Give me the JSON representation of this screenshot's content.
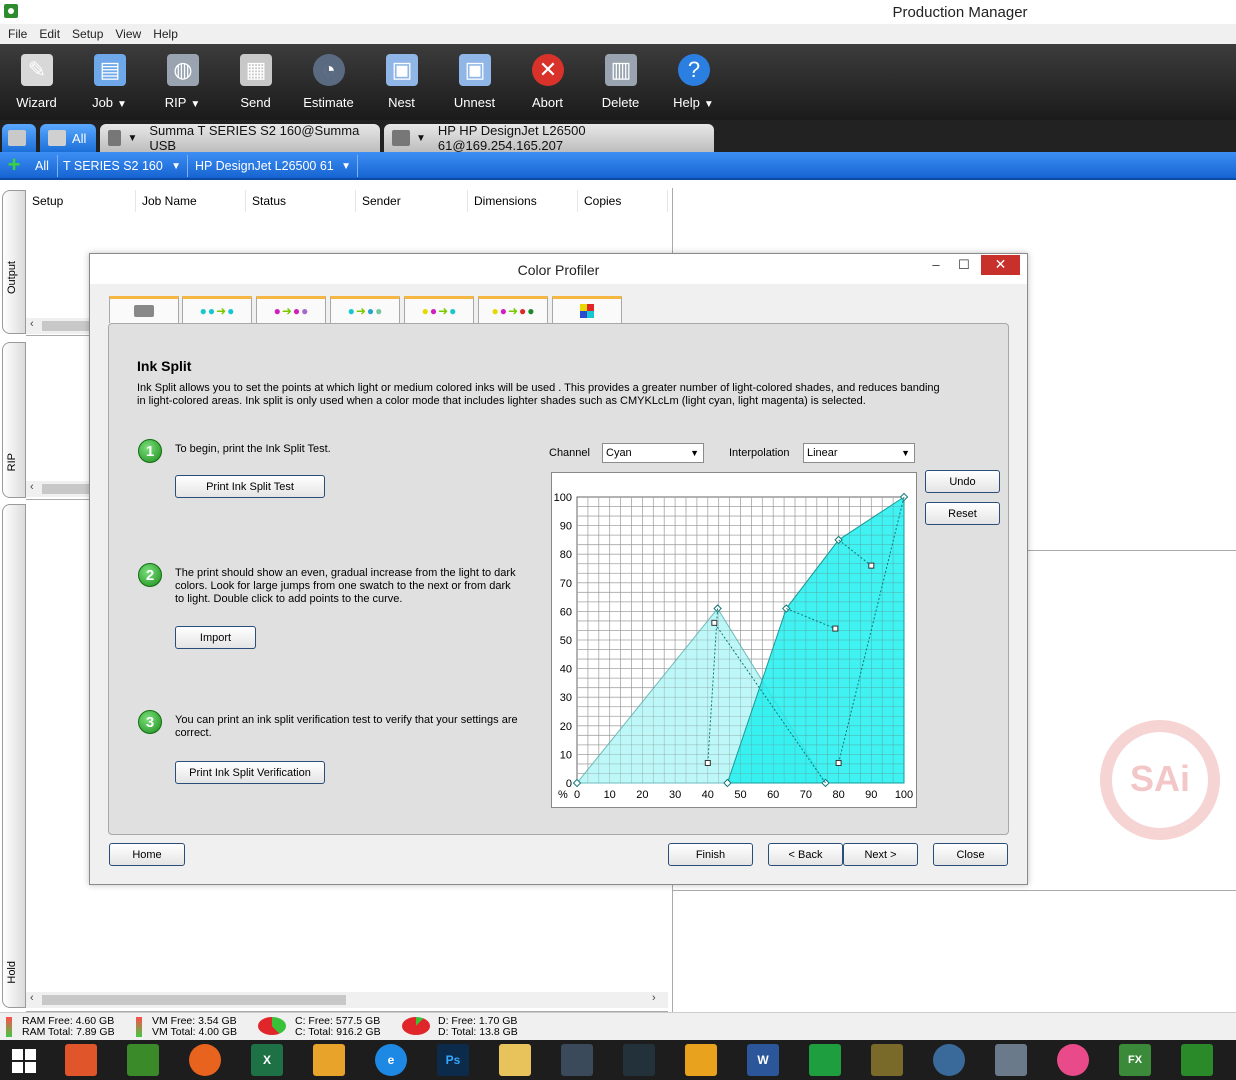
{
  "app": {
    "title": "Production Manager"
  },
  "menu": [
    "File",
    "Edit",
    "Setup",
    "View",
    "Help"
  ],
  "toolbar": [
    {
      "label": "Wizard",
      "icon": "wizard-icon",
      "color": "#d8d8d8",
      "dropdown": false
    },
    {
      "label": "Job",
      "icon": "folder-icon",
      "color": "#6fa8e8",
      "dropdown": true
    },
    {
      "label": "RIP",
      "icon": "globe-icon",
      "color": "#9aa4b0",
      "dropdown": true
    },
    {
      "label": "Send",
      "icon": "printer-icon",
      "color": "#c8c8c8",
      "dropdown": false
    },
    {
      "label": "Estimate",
      "icon": "gauge-icon",
      "color": "#5a6a80",
      "dropdown": false
    },
    {
      "label": "Nest",
      "icon": "nest-icon",
      "color": "#8fb6e6",
      "dropdown": false
    },
    {
      "label": "Unnest",
      "icon": "unnest-icon",
      "color": "#8fb6e6",
      "dropdown": false
    },
    {
      "label": "Abort",
      "icon": "abort-icon",
      "color": "#d8322a",
      "dropdown": false
    },
    {
      "label": "Delete",
      "icon": "trash-icon",
      "color": "#9aa4b0",
      "dropdown": false
    },
    {
      "label": "Help",
      "icon": "help-icon",
      "color": "#2b7fe0",
      "dropdown": true
    }
  ],
  "printer_tabs": [
    "All",
    "Summa T SERIES S2 160@Summa USB",
    "HP HP DesignJet L26500 61@169.254.165.207"
  ],
  "filters": [
    "All",
    "T SERIES S2 160",
    "HP DesignJet L26500 61"
  ],
  "table": {
    "columns": [
      "Setup",
      "Job Name",
      "Status",
      "Sender",
      "Dimensions",
      "Copies"
    ]
  },
  "side_panels": [
    "Output",
    "RIP",
    "Hold"
  ],
  "status": {
    "ram_free": "RAM Free: 4.60 GB",
    "ram_total": "RAM Total: 7.89 GB",
    "vm_free": "VM Free: 3.54 GB",
    "vm_total": "VM Total: 4.00 GB",
    "c_free": "C: Free: 577.5 GB",
    "c_total": "C: Total: 916.2 GB",
    "d_free": "D: Free: 1.70 GB",
    "d_total": "D: Total: 13.8 GB"
  },
  "watermark": "SAi",
  "dialog": {
    "title": "Color Profiler",
    "heading": "Ink Split",
    "description": "Ink Split allows you to set the points at which light or medium colored inks will be used . This provides a greater number of light-colored shades, and reduces banding in light-colored areas. Ink split is only used when a color mode that includes lighter shades such as CMYKLcLm (light cyan, light magenta) is selected.",
    "steps": [
      {
        "num": "1",
        "text": "To begin, print the Ink Split Test.",
        "button": "Print Ink Split Test"
      },
      {
        "num": "2",
        "text": "The print should show an even, gradual increase from the light to dark colors. Look for large jumps from one swatch to the next or from dark to light. Double click to add points to the curve.",
        "button": "Import"
      },
      {
        "num": "3",
        "text": "You can print an ink split verification test to verify that your settings are correct.",
        "button": "Print Ink Split Verification"
      }
    ],
    "channel_label": "Channel",
    "channel_value": "Cyan",
    "interp_label": "Interpolation",
    "interp_value": "Linear",
    "undo": "Undo",
    "reset": "Reset",
    "buttons": {
      "home": "Home",
      "finish": "Finish",
      "back": "< Back",
      "next": "Next >",
      "close": "Close"
    },
    "tabs": [
      "printer-tab-icon",
      "cyan-ink-split-icon",
      "magenta-ink-split-icon",
      "multi-ink-split-icon",
      "cmy-ink-split-icon",
      "cmyk-ink-split-icon",
      "color-grid-icon"
    ]
  },
  "chart_data": {
    "type": "line",
    "xlim": [
      0,
      100
    ],
    "ylim": [
      0,
      100
    ],
    "x_ticks": [
      "0",
      "10",
      "20",
      "30",
      "40",
      "50",
      "60",
      "70",
      "80",
      "90",
      "100"
    ],
    "y_ticks": [
      "0",
      "10",
      "20",
      "30",
      "40",
      "50",
      "60",
      "70",
      "80",
      "90",
      "100"
    ],
    "x_unit": "%",
    "grid": true,
    "series": [
      {
        "fill": "#b6f6f6",
        "stroke": "#6fbcbc",
        "points": [
          [
            0,
            0
          ],
          [
            43,
            61
          ],
          [
            76,
            0
          ]
        ],
        "handles": [
          [
            40,
            7
          ],
          [
            42,
            56
          ]
        ]
      },
      {
        "fill": "#1ff0ee",
        "stroke": "#119c9c",
        "points": [
          [
            46,
            0
          ],
          [
            64,
            61
          ],
          [
            80,
            85
          ],
          [
            100,
            100
          ]
        ],
        "handles": [
          [
            79,
            54
          ],
          [
            90,
            76
          ],
          [
            80,
            7
          ]
        ]
      }
    ]
  }
}
